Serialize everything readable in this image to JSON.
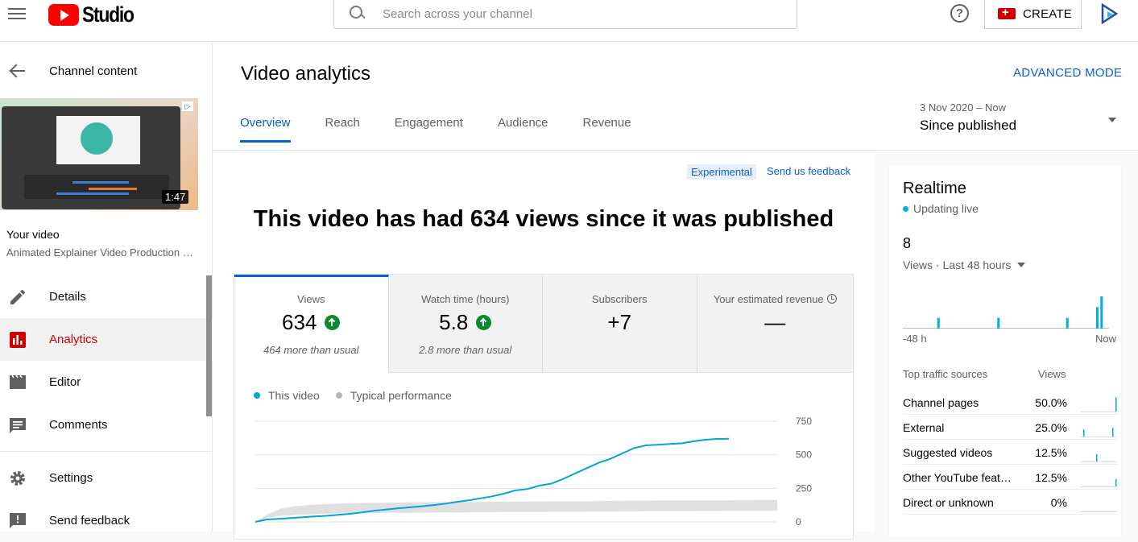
{
  "header": {
    "logo_text": "Studio",
    "search_placeholder": "Search across your channel",
    "help_glyph": "?",
    "create_label": "CREATE"
  },
  "sidebar": {
    "back_label": "Channel content",
    "thumbnail_duration": "1:47",
    "your_video_label": "Your video",
    "video_title": "Animated Explainer Video Production Workflow",
    "nav_items": [
      {
        "id": "details",
        "label": "Details",
        "icon": "pencil-icon"
      },
      {
        "id": "analytics",
        "label": "Analytics",
        "icon": "analytics-icon",
        "active": true
      },
      {
        "id": "editor",
        "label": "Editor",
        "icon": "clapperboard-icon"
      },
      {
        "id": "comments",
        "label": "Comments",
        "icon": "comment-icon"
      }
    ],
    "nav_bottom": [
      {
        "id": "settings",
        "label": "Settings",
        "icon": "gear-icon"
      },
      {
        "id": "send_feedback",
        "label": "Send feedback",
        "icon": "feedback-icon"
      }
    ]
  },
  "main": {
    "title": "Video analytics",
    "advanced_mode": "ADVANCED MODE",
    "tabs": [
      "Overview",
      "Reach",
      "Engagement",
      "Audience",
      "Revenue"
    ],
    "active_tab": "Overview",
    "date_range": {
      "sub": "3 Nov 2020 – Now",
      "main": "Since published"
    },
    "experimental_badge": "Experimental",
    "feedback_link": "Send us feedback",
    "headline": "This video has had 634 views since it was published",
    "metrics": [
      {
        "label": "Views",
        "value": "634",
        "trend": "up",
        "sub": "464 more than usual",
        "active": true
      },
      {
        "label": "Watch time (hours)",
        "value": "5.8",
        "trend": "up",
        "sub": "2.8 more than usual"
      },
      {
        "label": "Subscribers",
        "value": "+7",
        "trend": "",
        "sub": ""
      },
      {
        "label": "Your estimated revenue",
        "value": "—",
        "trend": "",
        "sub": ""
      }
    ],
    "legend": [
      {
        "label": "This video",
        "color": "#00a6d6"
      },
      {
        "label": "Typical performance",
        "color": "#b7b7b7"
      }
    ]
  },
  "chart_data": {
    "type": "line",
    "title": "",
    "xlabel": "",
    "ylabel": "",
    "ylim": [
      0,
      750
    ],
    "yticks": [
      "750",
      "500",
      "250",
      "0"
    ],
    "grid": true,
    "series": [
      {
        "name": "This video",
        "color": "#00a6d6",
        "values": [
          0,
          18,
          22,
          28,
          35,
          40,
          45,
          52,
          60,
          70,
          82,
          92,
          100,
          108,
          115,
          125,
          135,
          148,
          160,
          175,
          190,
          210,
          235,
          245,
          270,
          285,
          320,
          360,
          400,
          440,
          470,
          510,
          550,
          570,
          575,
          580,
          585,
          600,
          612,
          618,
          620
        ]
      },
      {
        "name": "Typical performance",
        "color": "#e0e0e0",
        "band_low": [
          0,
          30,
          45,
          52,
          56,
          60,
          62,
          64,
          65,
          66,
          67,
          68,
          68,
          69,
          70,
          70,
          71,
          72,
          72,
          73,
          73,
          74,
          74,
          75,
          75,
          76,
          76,
          77,
          78,
          78,
          79,
          80,
          80,
          80,
          81,
          81,
          82,
          82,
          82,
          83,
          83
        ],
        "band_high": [
          0,
          60,
          100,
          115,
          125,
          130,
          135,
          138,
          140,
          142,
          143,
          144,
          145,
          146,
          147,
          147,
          148,
          149,
          150,
          150,
          151,
          152,
          152,
          153,
          153,
          154,
          155,
          156,
          157,
          158,
          158,
          159,
          160,
          160,
          160,
          161,
          161,
          162,
          162,
          163,
          163
        ]
      }
    ]
  },
  "realtime": {
    "title": "Realtime",
    "live_label": "Updating live",
    "count": "8",
    "period_label": "Views · Last 48 hours",
    "chart_bars": [
      0,
      0,
      0,
      0,
      0,
      0,
      0,
      0,
      1,
      0,
      0,
      0,
      0,
      0,
      0,
      0,
      0,
      0,
      0,
      0,
      0,
      0,
      1,
      0,
      0,
      0,
      0,
      0,
      0,
      0,
      0,
      0,
      0,
      0,
      0,
      0,
      0,
      0,
      1,
      0,
      0,
      0,
      0,
      0,
      0,
      2,
      3,
      0
    ],
    "axis_left": "-48 h",
    "axis_right": "Now",
    "traffic_header": "Top traffic sources",
    "views_header": "Views",
    "sources": [
      {
        "name": "Channel pages",
        "pct": "50.0%",
        "spark": [
          0,
          0,
          0,
          0,
          0,
          0,
          0,
          0,
          0,
          0,
          0,
          1
        ]
      },
      {
        "name": "External",
        "pct": "25.0%",
        "spark": [
          0,
          0.5,
          0,
          0,
          0,
          0,
          0,
          0,
          0,
          0,
          0.6,
          0
        ]
      },
      {
        "name": "Suggested videos",
        "pct": "12.5%",
        "spark": [
          0,
          0,
          0,
          0,
          0,
          0.5,
          0,
          0,
          0,
          0,
          0,
          0
        ]
      },
      {
        "name": "Other YouTube features",
        "pct": "12.5%",
        "spark": [
          0,
          0,
          0,
          0,
          0,
          0,
          0,
          0,
          0,
          0,
          0,
          0.5
        ]
      },
      {
        "name": "Direct or unknown",
        "pct": "0%",
        "spark": [
          0,
          0,
          0,
          0,
          0,
          0,
          0,
          0,
          0,
          0,
          0,
          0
        ]
      }
    ]
  }
}
